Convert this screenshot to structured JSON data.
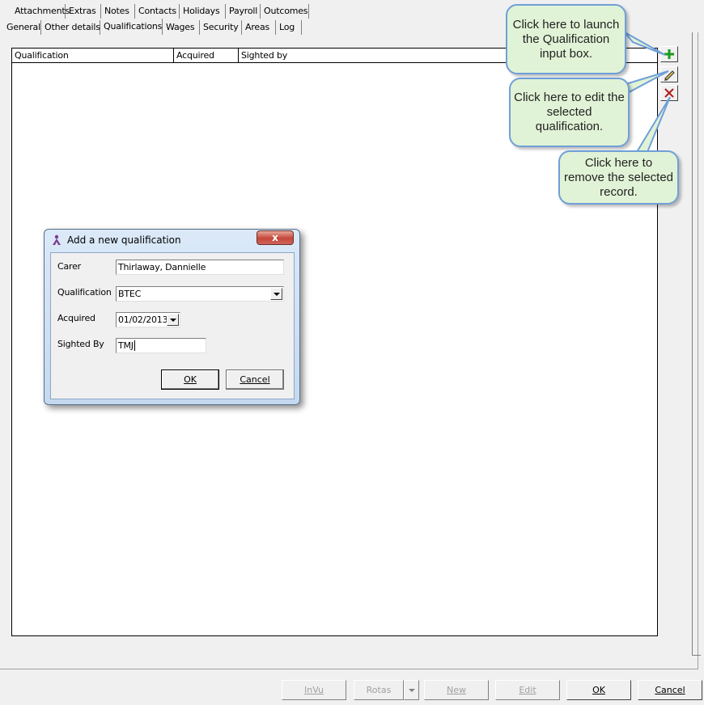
{
  "tabs_row1": [
    "Attachments",
    "Extras",
    "Notes",
    "Contacts",
    "Holidays",
    "Payroll",
    "Outcomes"
  ],
  "tabs_row2": [
    "General",
    "Other details",
    "Qualifications",
    "Wages",
    "Security",
    "Areas",
    "Log"
  ],
  "active_tab": "Qualifications",
  "grid": {
    "columns": [
      "Qualification",
      "Acquired",
      "Sighted by"
    ],
    "rows": []
  },
  "tools": {
    "add_icon": "plus-icon",
    "edit_icon": "pencil-icon",
    "delete_icon": "x-icon",
    "add_color": "#1a9a1a",
    "delete_color": "#b31b1b"
  },
  "callouts": {
    "add": "Click here to launch the Qualification input box.",
    "edit": "Click here to edit the selected qualification.",
    "remove": "Click here to remove the selected record."
  },
  "modal": {
    "title": "Add a new qualification",
    "close_label": "x",
    "fields": {
      "carer_label": "Carer",
      "carer_value": "Thirlaway, Dannielle",
      "qualification_label": "Qualification",
      "qualification_value": "BTEC",
      "acquired_label": "Acquired",
      "acquired_value": "01/02/2013",
      "sighted_label": "Sighted By",
      "sighted_value": "TMJ"
    },
    "ok_label": "OK",
    "cancel_label": "Cancel"
  },
  "bottom": {
    "invu": "InVu",
    "rotas": "Rotas",
    "new": "New",
    "edit": "Edit",
    "ok": "OK",
    "cancel": "Cancel"
  }
}
